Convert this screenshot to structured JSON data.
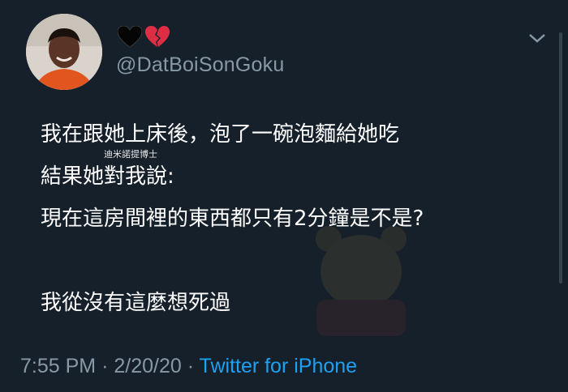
{
  "header": {
    "handle": "@DatBoiSonGoku",
    "emojis": [
      "black-heart-icon",
      "broken-heart-icon"
    ]
  },
  "tweet": {
    "line1": "我在跟她上床後，泡了一碗泡麵給她吃",
    "line2": "結果她對我說:",
    "line3": "現在這房間裡的東西都只有2分鐘是不是?",
    "line4": "我從沒有這麼想死過"
  },
  "watermark": "迪米諾提博士",
  "meta": {
    "time": "7:55 PM",
    "separator": "·",
    "date": "2/20/20",
    "source": "Twitter for iPhone"
  },
  "colors": {
    "background": "#15202b",
    "muted": "#8899a6",
    "link": "#1da1f2"
  }
}
